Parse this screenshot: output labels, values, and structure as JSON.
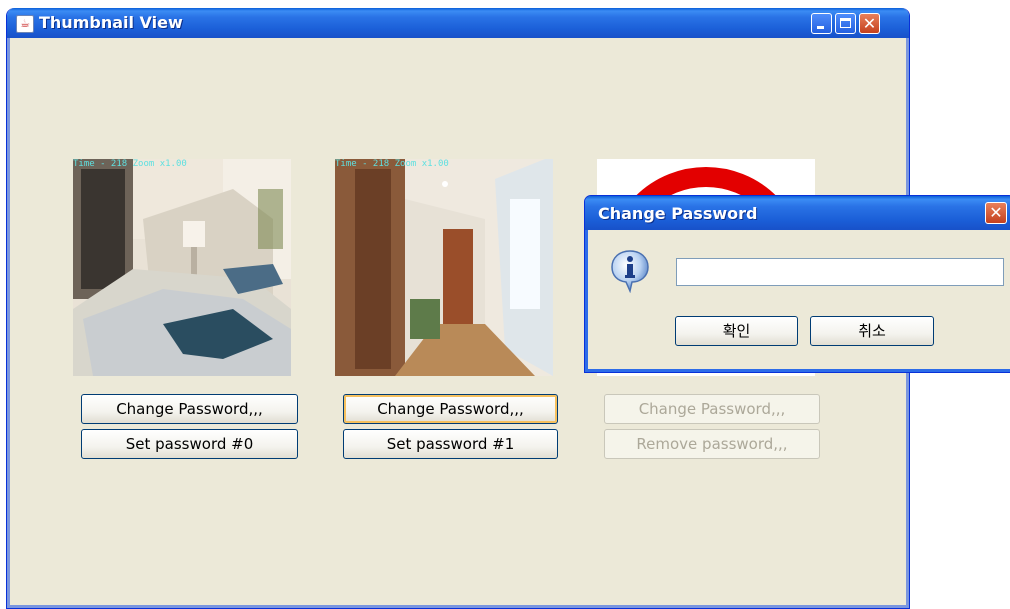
{
  "window": {
    "title": "Thumbnail View",
    "icon": "java-cup-icon",
    "controls": [
      "minimize",
      "maximize",
      "close"
    ],
    "close_glyph": "✕"
  },
  "thumbnails": [
    {
      "overlay": "Time - 218 Zoom x1.00",
      "image": "bedroom-photo",
      "change_label": "Change Password,,,",
      "second_label": "Set password #0",
      "enabled": true
    },
    {
      "overlay": "Time - 218 Zoom x1.00",
      "image": "hallway-photo",
      "change_label": "Change Password,,,",
      "second_label": "Set password #1",
      "enabled": true,
      "focused": true
    },
    {
      "overlay": "",
      "image": "red-circle-logo",
      "change_label": "Change Password,,,",
      "second_label": "Remove password,,,",
      "enabled": false
    }
  ],
  "dialog": {
    "title": "Change Password",
    "icon": "info-icon",
    "password_value": "",
    "ok_label": "확인",
    "cancel_label": "취소",
    "close_glyph": "✕"
  },
  "colors": {
    "title_bar": "#1b5fd8",
    "window_bg": "#ece9d8",
    "close_button": "#d9582f",
    "focus_ring": "#f6c15f"
  }
}
